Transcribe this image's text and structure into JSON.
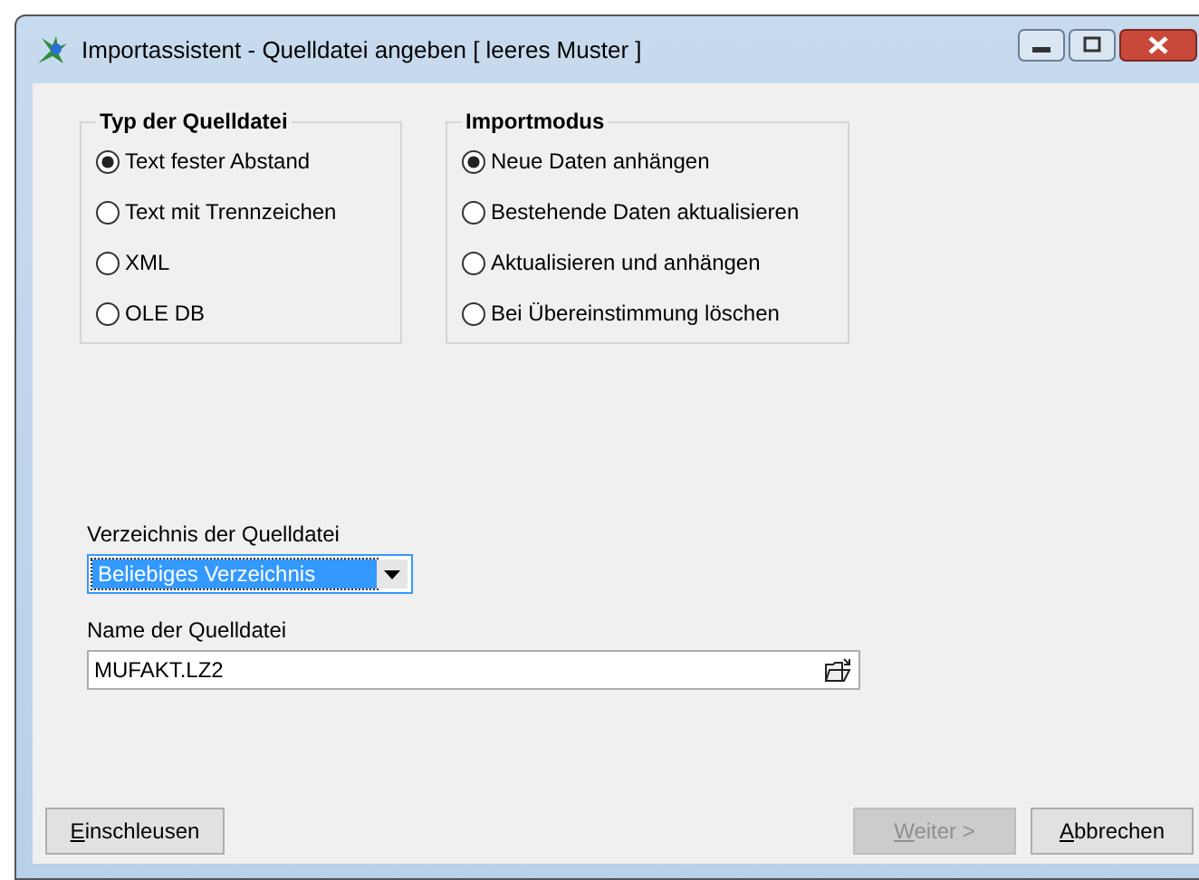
{
  "window": {
    "title": "Importassistent - Quelldatei angeben [ leeres Muster ]"
  },
  "groups": [
    {
      "title": "Typ der Quelldatei",
      "options": [
        {
          "label": "Text fester Abstand",
          "selected": true
        },
        {
          "label": "Text mit Trennzeichen",
          "selected": false
        },
        {
          "label": "XML",
          "selected": false
        },
        {
          "label": "OLE DB",
          "selected": false
        }
      ]
    },
    {
      "title": "Importmodus",
      "options": [
        {
          "label": "Neue Daten anhängen",
          "selected": true
        },
        {
          "label": "Bestehende Daten aktualisieren",
          "selected": false
        },
        {
          "label": "Aktualisieren und anhängen",
          "selected": false
        },
        {
          "label": "Bei Übereinstimmung löschen",
          "selected": false
        }
      ]
    }
  ],
  "directory": {
    "label": "Verzeichnis der Quelldatei",
    "value": "Beliebiges Verzeichnis"
  },
  "file": {
    "label": "Name der Quelldatei",
    "value": "MUFAKT.LZ2"
  },
  "buttons": [
    {
      "label": "Einschleusen",
      "disabled": false
    },
    {
      "label": "Weiter >",
      "disabled": true
    },
    {
      "label": "Abbrechen",
      "disabled": false
    }
  ]
}
